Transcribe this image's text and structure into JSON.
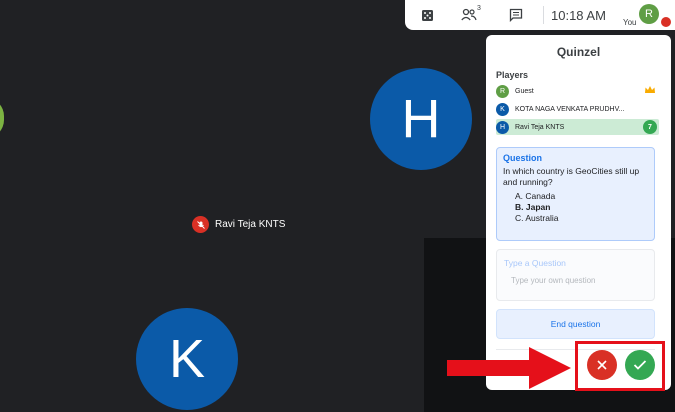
{
  "topbar": {
    "time": "10:18 AM",
    "participants_count": "3",
    "you_initial": "R",
    "you_label": "You",
    "icons": [
      "activities-icon",
      "people-icon",
      "chat-icon"
    ]
  },
  "stage": {
    "tile_h_initial": "H",
    "tile_k_initial": "K",
    "muted_name": "Ravi Teja KNTS"
  },
  "panel": {
    "title": "Quinzel",
    "players_label": "Players",
    "players": [
      {
        "initial": "R",
        "name": "Guest",
        "color": "#5f9e45"
      },
      {
        "initial": "K",
        "name": "KOTA NAGA VENKATA PRUDHV...",
        "color": "#0b5aa8"
      },
      {
        "initial": "H",
        "name": "Ravi Teja KNTS",
        "color": "#0b5aa8",
        "score": "7"
      }
    ],
    "question": {
      "label": "Question",
      "text": "In which country is GeoCities still up and running?",
      "options": [
        "A. Canada",
        "B. Japan",
        "C. Australia"
      ]
    },
    "type_question": {
      "label": "Type a Question",
      "placeholder": "Type your own question"
    },
    "end_button": "End question"
  },
  "colors": {
    "reject": "#d93025",
    "accept": "#34a853",
    "highlight": "#e5101a"
  }
}
